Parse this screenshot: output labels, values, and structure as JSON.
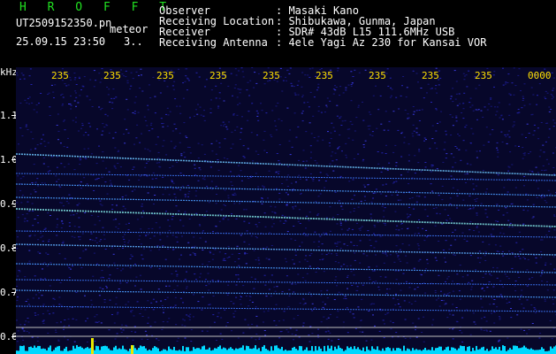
{
  "header": {
    "brand": "H R O F F T",
    "filename": "UT2509152350.pn",
    "mode": "meteor",
    "datetime": "25.09.15 23:50",
    "count": "3..",
    "fields": [
      {
        "label": "Observer",
        "value": ": Masaki Kano"
      },
      {
        "label": "Receiving Location",
        "value": ": Shibukawa, Gunma, Japan"
      },
      {
        "label": "Receiver",
        "value": ": SDR# 43dB L15 111.6MHz USB"
      },
      {
        "label": "Receiving Antenna",
        "value": ": 4ele Yagi Az 230 for Kansai VOR"
      }
    ]
  },
  "axis": {
    "y_unit": "kHz",
    "y_ticks": [
      "1.1",
      "1.0",
      "0.9",
      "0.8",
      "0.7",
      "0.6"
    ],
    "x_ticks": [
      "235",
      "235",
      "235",
      "235",
      "235",
      "235",
      "235",
      "235",
      "235",
      "0000"
    ]
  },
  "colors": {
    "background": "#000000",
    "noise": "#1a1aa0",
    "band": "#5fb0ff",
    "baseline": "#00e0ff",
    "x_labels": "#ffe000",
    "brand": "#21e021"
  }
}
